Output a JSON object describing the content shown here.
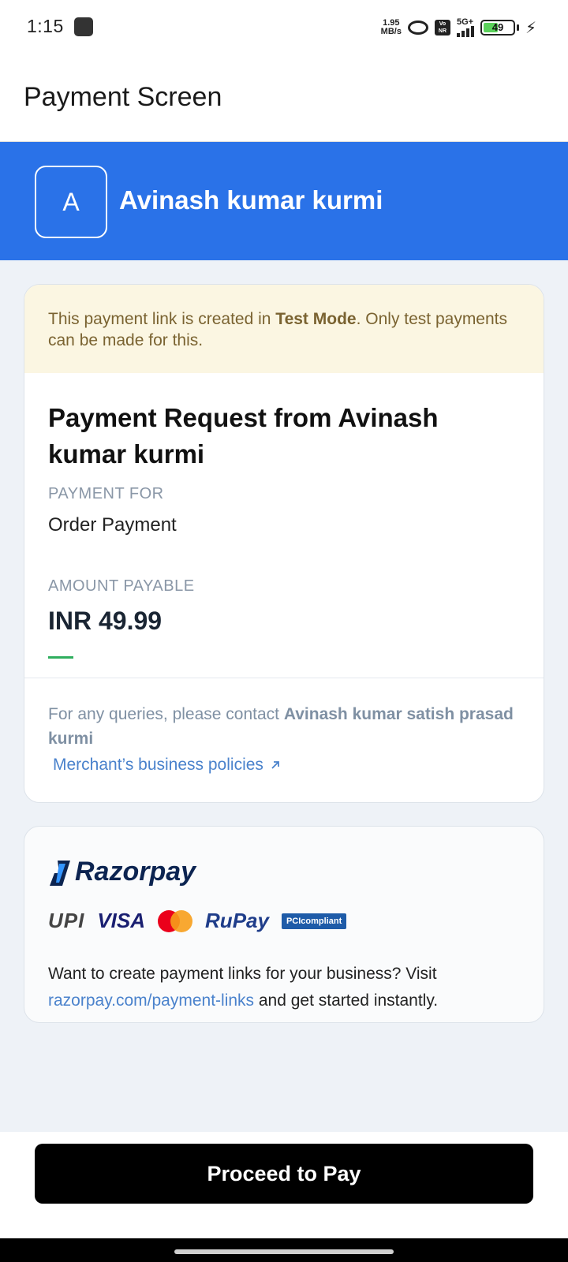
{
  "status_bar": {
    "time": "1:15",
    "net_speed_value": "1.95",
    "net_speed_unit": "MB/s",
    "volte_label": "Vo NR",
    "network_type": "5G+",
    "battery_level": "49",
    "icons": [
      "app-notification-icon",
      "hotspot-icon",
      "volte-icon",
      "signal-icon",
      "battery-icon",
      "charging-bolt-icon"
    ]
  },
  "app_bar": {
    "title": "Payment Screen"
  },
  "merchant": {
    "avatar_letter": "A",
    "name": "Avinash kumar kurmi",
    "header_color": "#2a72e8"
  },
  "test_banner": {
    "text_before": "This payment link is created in ",
    "text_bold": "Test Mode",
    "text_after": ". Only test payments can be made for this."
  },
  "request": {
    "title": "Payment Request from Avinash kumar kurmi",
    "payment_for_label": "PAYMENT FOR",
    "payment_for_value": "Order Payment",
    "amount_label": "AMOUNT PAYABLE",
    "amount_value": "INR 49.99"
  },
  "contact": {
    "text_before": "For any queries, please contact ",
    "contact_name": "Avinash kumar satish prasad kurmi",
    "policy_link": "Merchant’s business policies"
  },
  "razorpay": {
    "logo_text": "Razorpay",
    "methods": {
      "upi": "UPI",
      "visa": "VISA",
      "rupay": "RuPay",
      "pci": "PCIcompliant"
    },
    "promo_before": "Want to create payment links for your business? Visit ",
    "promo_link": "razorpay.com/payment-links",
    "promo_after": " and get started instantly."
  },
  "footer": {
    "button_label": "Proceed to Pay"
  }
}
